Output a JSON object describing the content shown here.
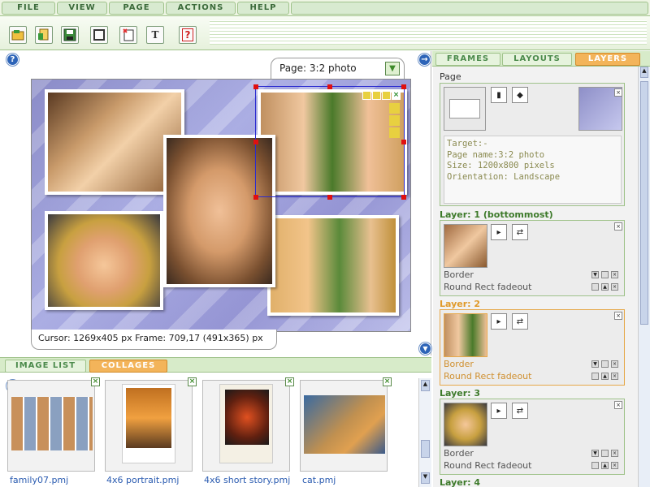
{
  "menu": {
    "file": "FILE",
    "view": "VIEW",
    "page": "PAGE",
    "actions": "ACTIONS",
    "help": "HELP"
  },
  "toolbar": {
    "buttons": [
      {
        "icon": "open-folder-icon"
      },
      {
        "icon": "new-file-icon"
      },
      {
        "icon": "save-icon"
      },
      {
        "icon": "frame-icon"
      },
      {
        "icon": "add-image-icon"
      },
      {
        "icon": "text-tool-icon"
      },
      {
        "icon": "help-icon"
      }
    ],
    "text_tool_glyph": "T",
    "help_glyph": "?"
  },
  "canvas": {
    "help_glyph": "?",
    "page_select": "Page: 3:2 photo",
    "dropdown_glyph": "▼",
    "status": "Cursor: 1269x405 px Frame: 709,17 (491x365) px",
    "nav_glyph": "→"
  },
  "right_tabs": {
    "frames": "FRAMES",
    "layouts": "LAYOUTS",
    "layers": "LAYERS"
  },
  "layers_panel": {
    "page_label": "Page",
    "page_info": [
      "Target:-",
      "Page name:3:2 photo",
      "Size: 1200x800 pixels",
      "Orientation: Landscape"
    ],
    "layers": [
      {
        "title": "Layer: 1 (bottommost)",
        "border": "Border",
        "effect": "Round Rect fadeout"
      },
      {
        "title": "Layer: 2",
        "border": "Border",
        "effect": "Round Rect fadeout"
      },
      {
        "title": "Layer: 3",
        "border": "Border",
        "effect": "Round Rect fadeout"
      },
      {
        "title": "Layer: 4"
      }
    ],
    "close_glyph": "×"
  },
  "bottom_tabs": {
    "image_list": "IMAGE LIST",
    "collages": "COLLAGES"
  },
  "collages": [
    {
      "name": "family07.pmj"
    },
    {
      "name": "4x6 portrait.pmj"
    },
    {
      "name": "4x6 short story.pmj"
    },
    {
      "name": "cat.pmj"
    }
  ],
  "colors": {
    "accent": "#f3b45a",
    "brand_green": "#9fc28a",
    "selection": "#2a2ad0",
    "handle": "#e01010"
  }
}
